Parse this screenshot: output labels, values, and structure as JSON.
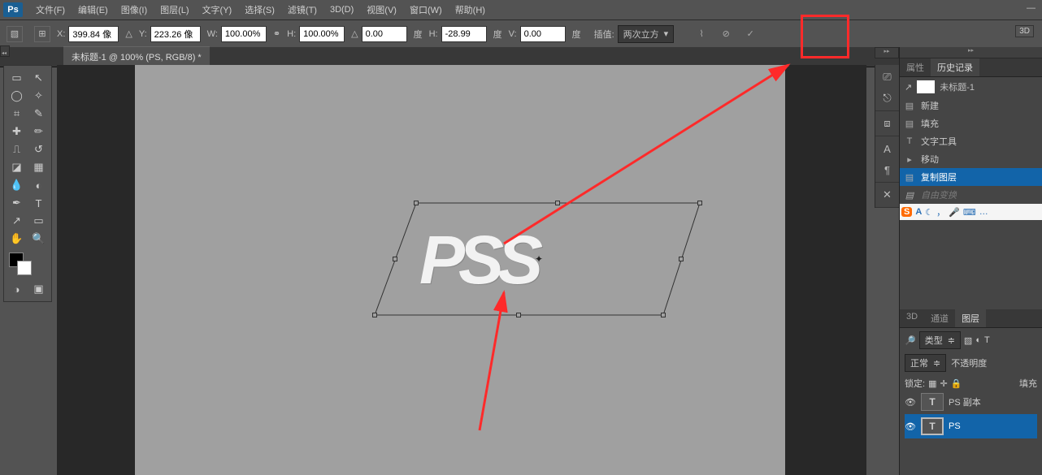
{
  "menu": {
    "items": [
      "文件(F)",
      "编辑(E)",
      "图像(I)",
      "图层(L)",
      "文字(Y)",
      "选择(S)",
      "滤镜(T)",
      "3D(D)",
      "视图(V)",
      "窗口(W)",
      "帮助(H)"
    ]
  },
  "options": {
    "x_label": "X:",
    "x": "399.84 像",
    "y_label": "Y:",
    "y": "223.26 像",
    "w_label": "W:",
    "w": "100.00%",
    "h_label": "H:",
    "h": "100.00%",
    "angle": "0.00",
    "angle_unit": "度",
    "hskew_label": "H:",
    "hskew": "-28.99",
    "hskew_unit": "度",
    "vskew_label": "V:",
    "vskew": "0.00",
    "vskew_unit": "度",
    "interp_label": "插值:",
    "interp": "两次立方",
    "threeD": "3D"
  },
  "tab": {
    "title": "未标题-1 @ 100% (PS, RGB/8) *"
  },
  "canvas": {
    "text": "PS"
  },
  "right_icons": [
    "⎚",
    "⎋",
    "⧈",
    "A",
    "¶",
    "✕"
  ],
  "history": {
    "tabs": [
      "属性",
      "历史记录"
    ],
    "doc": "未标题-1",
    "items": [
      {
        "icon": "▤",
        "label": "新建",
        "sel": false
      },
      {
        "icon": "▤",
        "label": "填充",
        "sel": false
      },
      {
        "icon": "T",
        "label": "文字工具",
        "sel": false
      },
      {
        "icon": "▸",
        "label": "移动",
        "sel": false
      },
      {
        "icon": "▤",
        "label": "复制图层",
        "sel": true
      },
      {
        "icon": "▤",
        "label": "自由变换",
        "dim": true
      }
    ],
    "ime": {
      "letter": "A",
      "icons": [
        "☾",
        "，",
        "🎤",
        "⌨",
        "…"
      ]
    }
  },
  "layers": {
    "lower_tabs": [
      "3D",
      "通道",
      "图层"
    ],
    "kind_label": "类型",
    "blend": "正常",
    "opacity_label": "不透明度",
    "lock_label": "锁定:",
    "fill_label": "填充",
    "rows": [
      {
        "name": "PS 副本",
        "t": "T"
      },
      {
        "name": "PS",
        "t": "T",
        "sel": true
      }
    ]
  }
}
